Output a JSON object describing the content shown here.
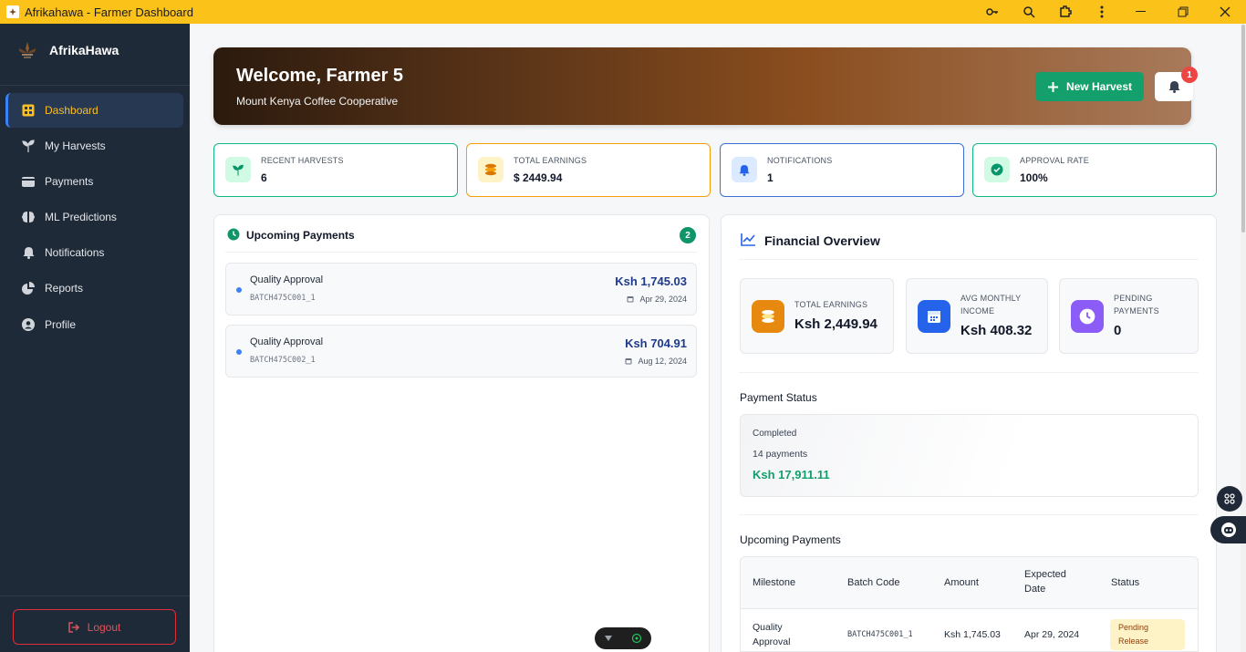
{
  "window": {
    "title": "Afrikahawa - Farmer Dashboard"
  },
  "brand": {
    "name": "AfrikaHawa"
  },
  "sidebar": {
    "items": [
      {
        "label": "Dashboard",
        "icon": "grid-icon",
        "active": true
      },
      {
        "label": "My Harvests",
        "icon": "seedling-icon"
      },
      {
        "label": "Payments",
        "icon": "wallet-icon"
      },
      {
        "label": "ML Predictions",
        "icon": "brain-icon"
      },
      {
        "label": "Notifications",
        "icon": "bell-icon"
      },
      {
        "label": "Reports",
        "icon": "pie-chart-icon"
      },
      {
        "label": "Profile",
        "icon": "user-circle-icon"
      }
    ],
    "logout_label": "Logout"
  },
  "banner": {
    "welcome": "Welcome, Farmer 5",
    "cooperative": "Mount Kenya Coffee Cooperative",
    "new_harvest_label": "New Harvest",
    "notification_count": "1"
  },
  "stats": [
    {
      "label": "RECENT HARVESTS",
      "value": "6",
      "color": "#10b981"
    },
    {
      "label": "TOTAL EARNINGS",
      "value": "$ 2449.94",
      "color": "#f59e0b"
    },
    {
      "label": "NOTIFICATIONS",
      "value": "1",
      "color": "#3b6fd6"
    },
    {
      "label": "APPROVAL RATE",
      "value": "100%",
      "color": "#10b981"
    }
  ],
  "upcoming": {
    "title": "Upcoming Payments",
    "count": "2",
    "items": [
      {
        "label": "Quality Approval",
        "batch": "BATCH475C001_1",
        "amount": "Ksh 1,745.03",
        "date": "Apr 29, 2024"
      },
      {
        "label": "Quality Approval",
        "batch": "BATCH475C002_1",
        "amount": "Ksh 704.91",
        "date": "Aug 12, 2024"
      }
    ]
  },
  "financial": {
    "title": "Financial Overview",
    "cards": [
      {
        "label": "TOTAL EARNINGS",
        "value": "Ksh 2,449.94"
      },
      {
        "label_line1": "AVG MONTHLY",
        "label_line2": "INCOME",
        "value": "Ksh 408.32"
      },
      {
        "label_line1": "PENDING",
        "label_line2": "PAYMENTS",
        "value": "0"
      }
    ],
    "payment_status": {
      "title": "Payment Status",
      "status": "Completed",
      "count": "14 payments",
      "amount": "Ksh 17,911.11"
    },
    "upcoming_table": {
      "title": "Upcoming Payments",
      "headers": {
        "milestone": "Milestone",
        "batch": "Batch Code",
        "amount": "Amount",
        "date_line1": "Expected",
        "date_line2": "Date",
        "status": "Status"
      },
      "rows": [
        {
          "milestone_line1": "Quality",
          "milestone_line2": "Approval",
          "batch": "BATCH475C001_1",
          "amount": "Ksh 1,745.03",
          "date": "Apr 29, 2024",
          "status_line1": "Pending",
          "status_line2": "Release"
        }
      ]
    }
  }
}
